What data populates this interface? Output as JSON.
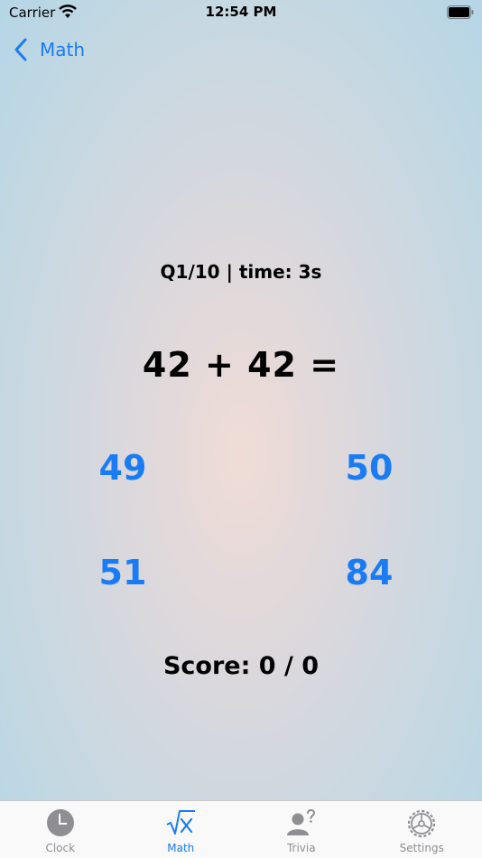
{
  "status_bar": {
    "carrier": "Carrier",
    "time": "12:54 PM"
  },
  "nav": {
    "back_label": "Math"
  },
  "quiz": {
    "question_status": "Q1/10 | time: 3s",
    "equation": "42 + 42 =",
    "answers": [
      "49",
      "50",
      "51",
      "84"
    ],
    "score": "Score: 0 / 0"
  },
  "tabs": [
    {
      "label": "Clock",
      "icon": "clock-icon",
      "active": false
    },
    {
      "label": "Math",
      "icon": "square-root-icon",
      "active": true
    },
    {
      "label": "Trivia",
      "icon": "person-question-icon",
      "active": false
    },
    {
      "label": "Settings",
      "icon": "gear-icon",
      "active": false
    }
  ],
  "colors": {
    "accent": "#1a7cf5",
    "inactive_tab": "#8e8e93",
    "text": "#000000"
  }
}
